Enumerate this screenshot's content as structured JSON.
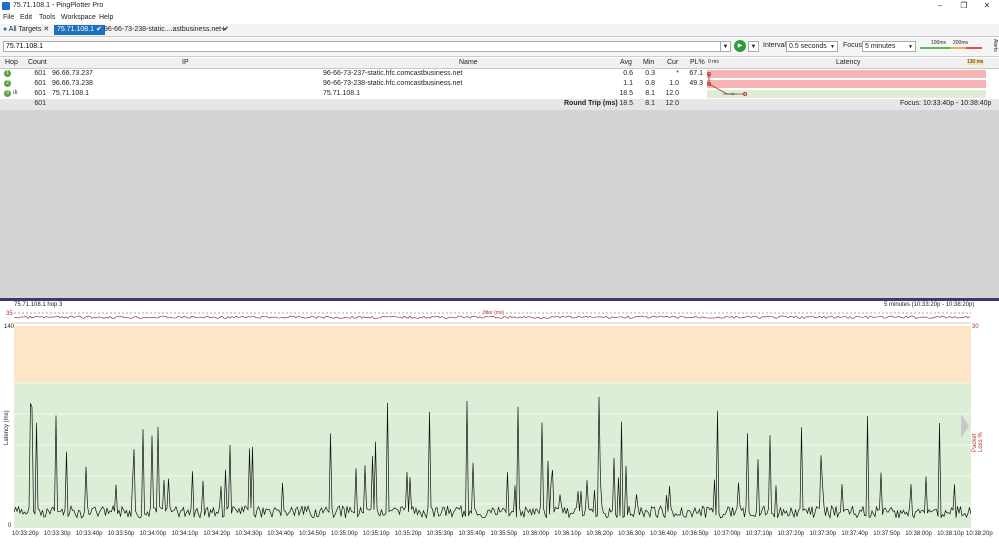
{
  "window": {
    "title": "75.71.108.1 - PingPlotter Pro",
    "minimize": "–",
    "maximize": "❐",
    "close": "✕"
  },
  "menu": [
    "File",
    "Edit",
    "Tools",
    "Workspace",
    "Help"
  ],
  "tabs": [
    {
      "label": "All Targets",
      "close": "✕"
    },
    {
      "label": "75.71.108.1",
      "close": "✔"
    },
    {
      "label": "96-66-73-238-static....astbusiness.net",
      "close": "✔"
    },
    {
      "label": "+"
    }
  ],
  "address": {
    "value": "75.71.108.1",
    "interval_label": "Interval",
    "interval_value": "0.5 seconds",
    "focus_label": "Focus",
    "focus_value": "5 minutes",
    "scale_100": "100ms",
    "scale_200": "200ms",
    "alerts": "Alerts"
  },
  "table": {
    "headers": {
      "hop": "Hop",
      "count": "Count",
      "ip": "IP",
      "name": "Name",
      "avg": "Avg",
      "min": "Min",
      "cur": "Cur",
      "pl": "PL%",
      "latency_start": "0 ms",
      "latency": "Latency",
      "latency_end": "130 ms"
    },
    "rows": [
      {
        "hop": "1",
        "count": "601",
        "ip": "96.66.73.237",
        "name": "96-66-73-237-static.hfc.comcastbusiness.net",
        "avg": "0.6",
        "min": "0.3",
        "cur": "*",
        "pl": "67.1"
      },
      {
        "hop": "2",
        "count": "601",
        "ip": "96.66.73.238",
        "name": "96-66-73-238-static.hfc.comcastbusiness.net",
        "avg": "1.1",
        "min": "0.8",
        "cur": "1.0",
        "pl": "49.3"
      },
      {
        "hop": "3",
        "count": "601",
        "ip": "75.71.108.1",
        "name": "75.71.108.1",
        "avg": "18.5",
        "min": "8.1",
        "cur": "12.0",
        "pl": ""
      }
    ],
    "summary": {
      "count": "601",
      "label": "Round Trip (ms)",
      "avg": "18.5",
      "min": "8.1",
      "cur": "12.0",
      "focus": "Focus: 10:33:40p - 10:38:40p"
    }
  },
  "graph": {
    "title": "75.71.108.1 hop 3",
    "range": "5 minutes (10:33:20p - 10:38:20p)",
    "jitter_label": "Jitter (ms)",
    "jitter_max": "35",
    "y_max": "140",
    "y_min": "0",
    "y_label": "Latency (ms)",
    "y2_label": "Packet Loss %",
    "y2_max": "30",
    "zones": {
      "warning_color": "#fde6c8",
      "ok_color": "#dcefd6",
      "line_color": "#111111"
    },
    "x_ticks": [
      "10:33:20p",
      "10:33:30p",
      "10:33:40p",
      "10:33:50p",
      "10:34:00p",
      "10:34:10p",
      "10:34:20p",
      "10:34:30p",
      "10:34:40p",
      "10:34:50p",
      "10:35:00p",
      "10:35:10p",
      "10:35:20p",
      "10:35:30p",
      "10:35:40p",
      "10:35:50p",
      "10:36:00p",
      "10:36:10p",
      "10:36:20p",
      "10:36:30p",
      "10:36:40p",
      "10:36:50p",
      "10:37:00p",
      "10:37:10p",
      "10:37:20p",
      "10:37:30p",
      "10:37:40p",
      "10:37:50p",
      "10:38:00p",
      "10:38:10p",
      "10:38:20p"
    ]
  }
}
